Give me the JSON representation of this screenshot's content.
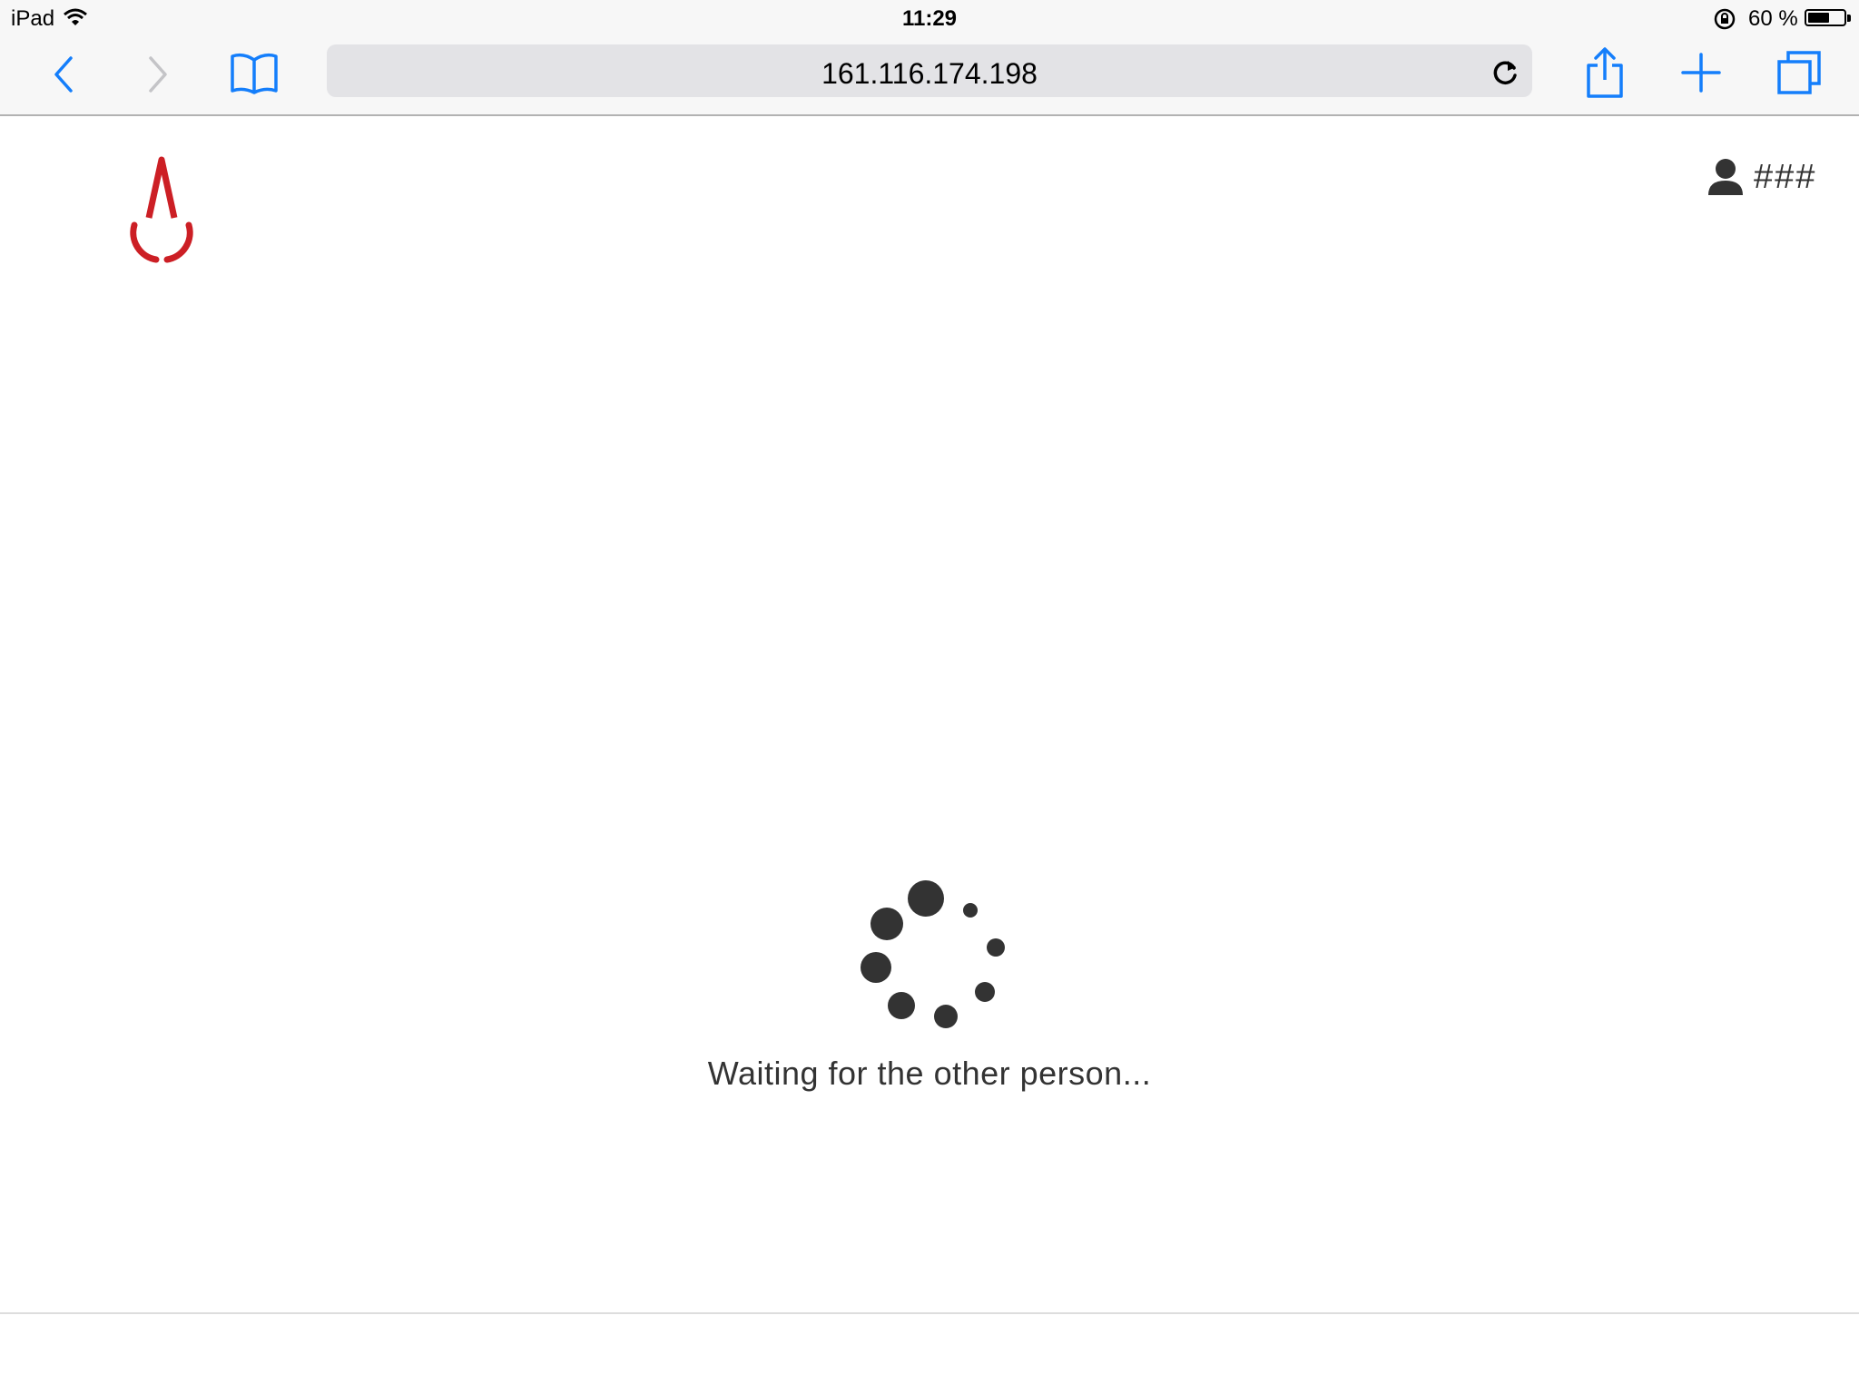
{
  "status_bar": {
    "device": "iPad",
    "time": "11:29",
    "battery_percent": "60 %",
    "battery_level": 0.6
  },
  "browser": {
    "address": "161.116.174.198",
    "accent_color": "#147efb"
  },
  "header": {
    "logo_icon": "blood-drop-icon",
    "logo_color": "#cc1f25",
    "user_icon": "user-icon",
    "user_name": "###"
  },
  "main": {
    "spinner_icon": "loading-spinner-icon",
    "message": "Waiting for the other person..."
  }
}
